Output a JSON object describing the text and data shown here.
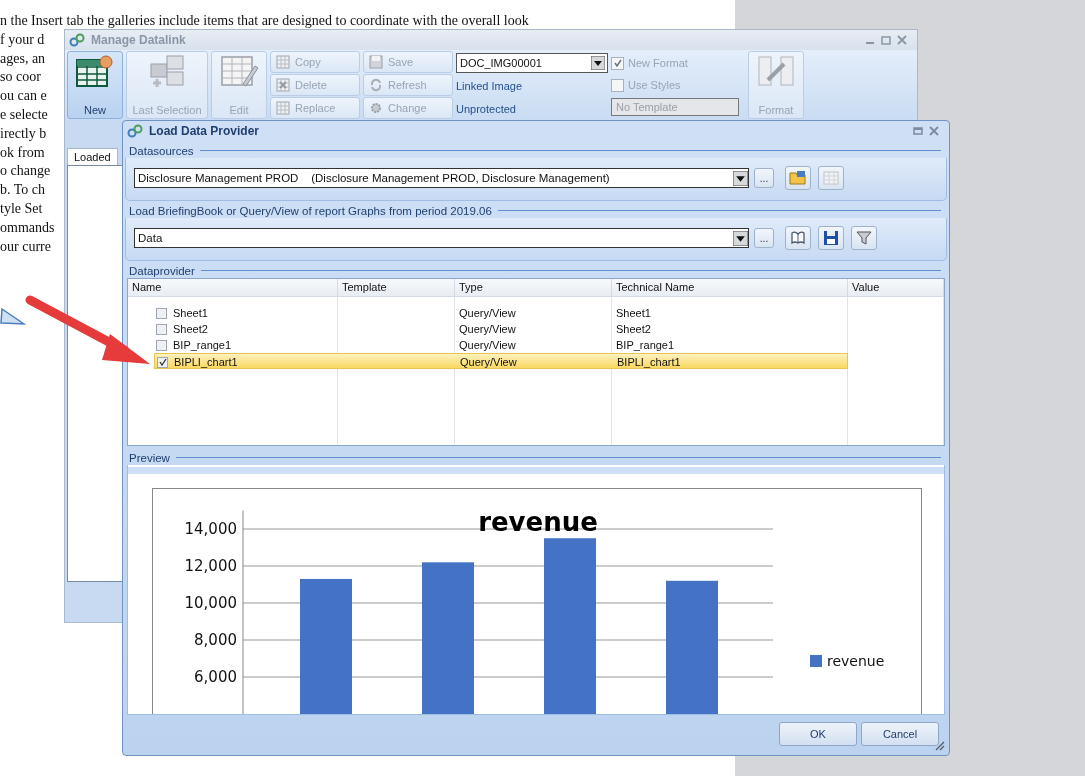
{
  "document": {
    "lines": [
      "n the Insert tab the galleries include items that are designed to coordinate with the overall look",
      "f your d",
      "ages, an",
      "so coor",
      "ou can e",
      "e selecte",
      "irectly b",
      "ok from",
      "o change",
      "b. To ch",
      "tyle Set",
      "ommands",
      "our curre"
    ]
  },
  "datalink_window": {
    "title": "Manage Datalink",
    "large_buttons": [
      {
        "label": "New",
        "disabled": false
      },
      {
        "label": "Last Selection",
        "disabled": true
      },
      {
        "label": "Edit",
        "disabled": true
      }
    ],
    "small_buttons": [
      {
        "label": "Copy",
        "disabled": true
      },
      {
        "label": "Delete",
        "disabled": true
      },
      {
        "label": "Replace",
        "disabled": true
      },
      {
        "label": "Save",
        "disabled": true
      },
      {
        "label": "Refresh",
        "disabled": true
      },
      {
        "label": "Change",
        "disabled": true
      }
    ],
    "image_select": {
      "value": "DOC_IMG00001"
    },
    "link_type": "Linked Image",
    "protection": "Unprotected",
    "checkboxes": [
      {
        "label": "New Format",
        "checked": true,
        "disabled": true
      },
      {
        "label": "Use Styles",
        "checked": false,
        "disabled": true
      }
    ],
    "template_select": {
      "value": "No Template",
      "disabled": true
    },
    "format_button": {
      "label": "Format",
      "disabled": true
    },
    "tabs": [
      {
        "label": "Loaded",
        "selected": true
      }
    ]
  },
  "dialog": {
    "title": "Load Data Provider",
    "datasources": {
      "legend": "Datasources",
      "value": "Disclosure Management PROD    (Disclosure Management PROD, Disclosure Management)",
      "browse": "..."
    },
    "source": {
      "legend": "Load BriefingBook or Query/View of report Graphs from period 2019.06",
      "value": "Data",
      "browse": "..."
    },
    "dataprovider": {
      "legend": "Dataprovider",
      "columns": [
        "Name",
        "Template",
        "Type",
        "Technical Name",
        "Value"
      ],
      "rows": [
        {
          "name": "Sheet1",
          "checked": false,
          "selected": false,
          "type": "Query/View",
          "technical_name": "Sheet1"
        },
        {
          "name": "Sheet2",
          "checked": false,
          "selected": false,
          "type": "Query/View",
          "technical_name": "Sheet2"
        },
        {
          "name": "BIP_range1",
          "checked": false,
          "selected": false,
          "type": "Query/View",
          "technical_name": "BIP_range1"
        },
        {
          "name": "BIPLI_chart1",
          "checked": true,
          "selected": true,
          "type": "Query/View",
          "technical_name": "BIPLI_chart1"
        }
      ]
    },
    "preview": {
      "legend": "Preview",
      "chart_data": {
        "type": "bar",
        "title": "revenue",
        "grid": true,
        "ylim": [
          4000,
          15000
        ],
        "series": [
          {
            "name": "revenue",
            "color": "#4472c4",
            "values": [
              11300,
              12200,
              13500,
              11200
            ]
          }
        ],
        "yticks": [
          {
            "value": 6000,
            "label": "6,000"
          },
          {
            "value": 8000,
            "label": "8,000"
          },
          {
            "value": 10000,
            "label": "10,000"
          },
          {
            "value": 12000,
            "label": "12,000"
          },
          {
            "value": 14000,
            "label": "14,000"
          }
        ]
      }
    },
    "buttons": [
      "OK",
      "Cancel"
    ]
  }
}
